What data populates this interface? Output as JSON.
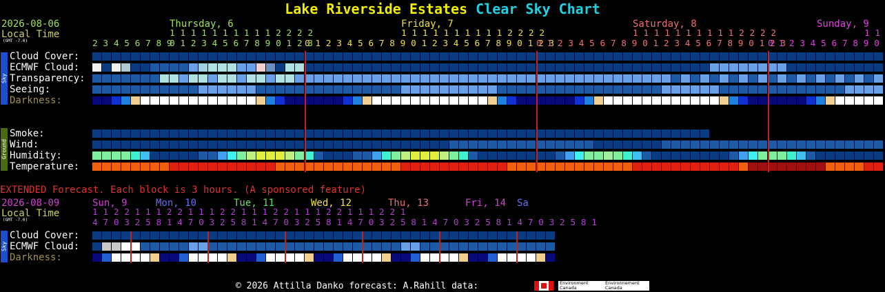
{
  "title": {
    "location": "Lake Riverside Estates",
    "chart": "Clear Sky Chart"
  },
  "header": {
    "date": "2026-08-06",
    "local_time": "Local Time",
    "gmt": "(GMT -7.0)",
    "days": [
      {
        "label": "Thursday, 6",
        "color": "#a0e060"
      },
      {
        "label": "Friday, 7",
        "color": "#f0e040"
      },
      {
        "label": "Saturday, 8",
        "color": "#f07070"
      },
      {
        "label": "Sunday, 9",
        "color": "#e040e0"
      }
    ],
    "tens_row": [
      "1 1 1 1 1 1 1 1 1 1 2 2 2 2",
      "1 1 1 1 1 1 1 1 1 1 2 2 2 2",
      "1 1 1 1 1 1 1 1 1 1 2 2 2 2",
      "1 1"
    ],
    "hours_row": [
      "2 3 4 5 6 7 8 9 ",
      "0 1 2 3 4 5 6 7 8 9 0 1 2 3 ",
      "0 1 2 3 4 5 6 7 8 9 0 1 2 3 4 5 6 7 8 9 0 1 2 3 ",
      "0 1 2 3 4 5 6 7 8 9 0 1 2 3 4 5 6 7 8 9 0 1 2 3 ",
      "0 1 2 3 4 5 6 7 8 9 0 1"
    ]
  },
  "sky_tag": "Sky",
  "ground_tag": "Ground",
  "rows": {
    "cloud_cover": "Cloud Cover:",
    "ecmwf": "ECMWF Cloud:",
    "transparency": "Transparency:",
    "seeing": "Seeing:",
    "darkness": "Darkness:",
    "smoke": "Smoke:",
    "wind": "Wind:",
    "humidity": "Humidity:",
    "temperature": "Temperature:"
  },
  "extended": {
    "note": "EXTENDED Forecast. Each block is 3 hours. (A sponsored feature)",
    "date": "2026-08-09",
    "local_time": "Local Time",
    "gmt": "(GMT -7.0)",
    "days": [
      {
        "label": "Sun, 9",
        "color": "#d040d0"
      },
      {
        "label": "Mon, 10",
        "color": "#6070f0"
      },
      {
        "label": "Tue, 11",
        "color": "#60e060"
      },
      {
        "label": "Wed, 12",
        "color": "#f0e040"
      },
      {
        "label": "Thu, 13",
        "color": "#f07070"
      },
      {
        "label": "Fri, 14",
        "color": "#d040d0"
      },
      {
        "label": "Sa",
        "color": "#6070f0"
      }
    ],
    "tens_row": "1 1 2 2     1 1 1 2 2     1 1 1 2 2     1 1 1 2 2     1 1 1 2 2     1 1 1 2 2     1",
    "hours_row": "4 7 0 3 2 5 8 1 4 7 0 3 2 5 8 1 4 7 0 3 2 5 8 1 4 7 0 3 2 5 8 1 4 7 0 3 2 5 8 1 4 7 0 3 2 5 8 1",
    "rows": {
      "cloud_cover": "Cloud Cover:",
      "ecmwf": "ECMWF Cloud:",
      "darkness": "Darkness:"
    }
  },
  "footer": {
    "text": "© 2026 Attilla Danko  forecast: A.Rahill  data:",
    "logo1": "Environment Canada",
    "logo2": "Environnement Canada"
  },
  "colors": {
    "title_location": "#f0f000",
    "title_chart": "#20d0e0",
    "grid_line": "#c8201a",
    "cloud_dark": "#0a3a80",
    "cloud_mid": "#1c5aa6",
    "transp_light": "#6aa0e6",
    "extended_note": "#e03030"
  }
}
